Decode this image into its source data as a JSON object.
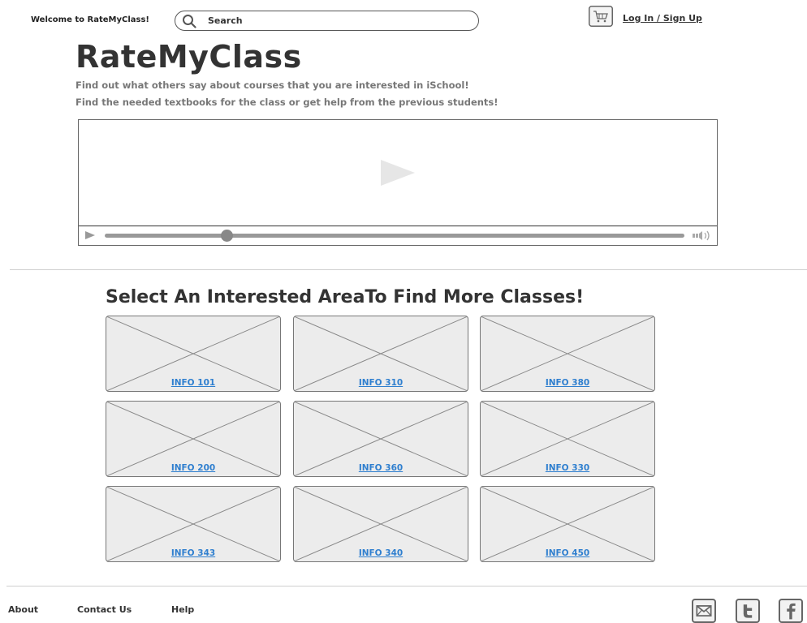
{
  "topbar": {
    "welcome": "Welcome to RateMyClass!",
    "search_placeholder": "Search",
    "login_label": "Log In / Sign Up"
  },
  "header": {
    "brand": "RateMyClass",
    "tagline_1": "Find out what others say about courses that you are interested in iSchool!",
    "tagline_2": "Find the needed textbooks for the class or get help from the previous students!"
  },
  "video": {
    "progress": 0.21
  },
  "section": {
    "title": "Select An Interested AreaTo Find More Classes!",
    "classes": [
      {
        "label": "INFO 101"
      },
      {
        "label": "INFO 310"
      },
      {
        "label": "INFO 380"
      },
      {
        "label": "INFO 200"
      },
      {
        "label": "INFO 360"
      },
      {
        "label": "INFO 330"
      },
      {
        "label": "INFO 343"
      },
      {
        "label": "INFO 340"
      },
      {
        "label": "INFO 450"
      }
    ]
  },
  "footer": {
    "links": [
      {
        "label": "About"
      },
      {
        "label": "Contact Us"
      },
      {
        "label": "Help"
      }
    ],
    "social_icons": [
      "email-icon",
      "twitter-icon",
      "facebook-icon"
    ]
  },
  "colors": {
    "link_blue": "#2f7fcf",
    "tile_fill": "#ececec",
    "text_dark": "#333333",
    "text_muted": "#777777"
  }
}
